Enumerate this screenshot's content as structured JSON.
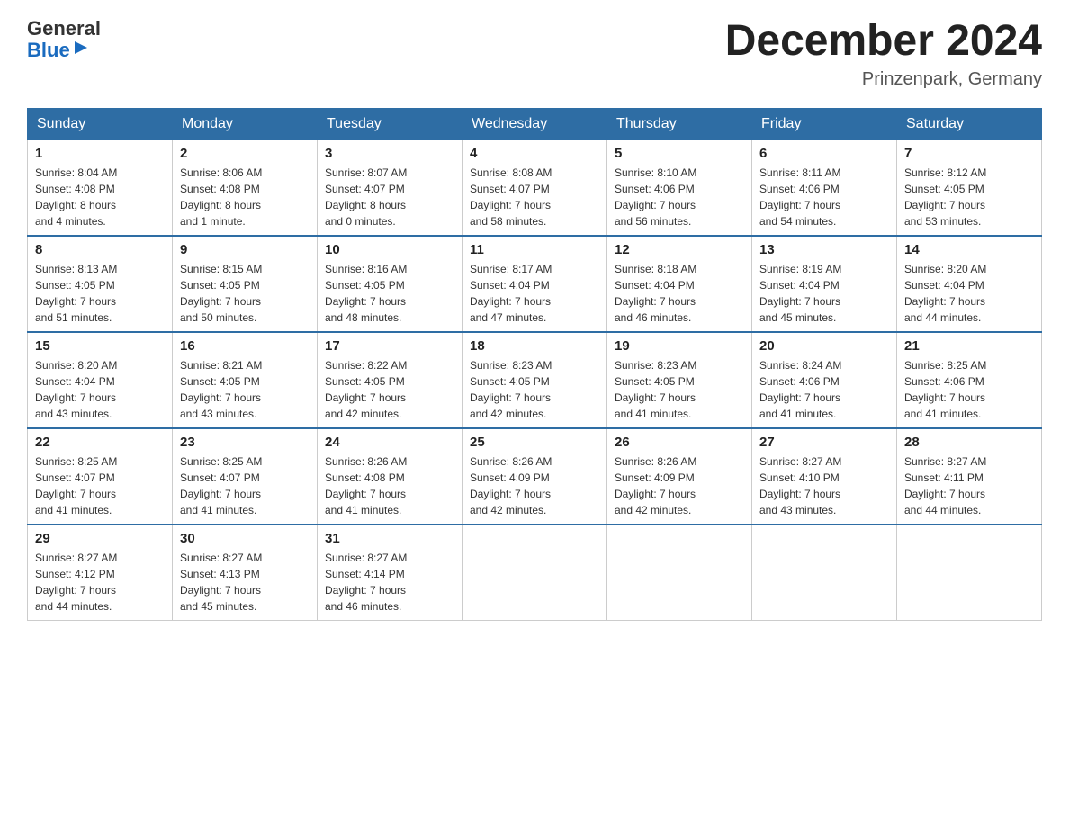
{
  "header": {
    "logo": {
      "general": "General",
      "blue": "Blue"
    },
    "title": "December 2024",
    "location": "Prinzenpark, Germany"
  },
  "days_of_week": [
    "Sunday",
    "Monday",
    "Tuesday",
    "Wednesday",
    "Thursday",
    "Friday",
    "Saturday"
  ],
  "weeks": [
    [
      {
        "day": "1",
        "sunrise": "8:04 AM",
        "sunset": "4:08 PM",
        "daylight": "8 hours and 4 minutes."
      },
      {
        "day": "2",
        "sunrise": "8:06 AM",
        "sunset": "4:08 PM",
        "daylight": "8 hours and 1 minute."
      },
      {
        "day": "3",
        "sunrise": "8:07 AM",
        "sunset": "4:07 PM",
        "daylight": "8 hours and 0 minutes."
      },
      {
        "day": "4",
        "sunrise": "8:08 AM",
        "sunset": "4:07 PM",
        "daylight": "7 hours and 58 minutes."
      },
      {
        "day": "5",
        "sunrise": "8:10 AM",
        "sunset": "4:06 PM",
        "daylight": "7 hours and 56 minutes."
      },
      {
        "day": "6",
        "sunrise": "8:11 AM",
        "sunset": "4:06 PM",
        "daylight": "7 hours and 54 minutes."
      },
      {
        "day": "7",
        "sunrise": "8:12 AM",
        "sunset": "4:05 PM",
        "daylight": "7 hours and 53 minutes."
      }
    ],
    [
      {
        "day": "8",
        "sunrise": "8:13 AM",
        "sunset": "4:05 PM",
        "daylight": "7 hours and 51 minutes."
      },
      {
        "day": "9",
        "sunrise": "8:15 AM",
        "sunset": "4:05 PM",
        "daylight": "7 hours and 50 minutes."
      },
      {
        "day": "10",
        "sunrise": "8:16 AM",
        "sunset": "4:05 PM",
        "daylight": "7 hours and 48 minutes."
      },
      {
        "day": "11",
        "sunrise": "8:17 AM",
        "sunset": "4:04 PM",
        "daylight": "7 hours and 47 minutes."
      },
      {
        "day": "12",
        "sunrise": "8:18 AM",
        "sunset": "4:04 PM",
        "daylight": "7 hours and 46 minutes."
      },
      {
        "day": "13",
        "sunrise": "8:19 AM",
        "sunset": "4:04 PM",
        "daylight": "7 hours and 45 minutes."
      },
      {
        "day": "14",
        "sunrise": "8:20 AM",
        "sunset": "4:04 PM",
        "daylight": "7 hours and 44 minutes."
      }
    ],
    [
      {
        "day": "15",
        "sunrise": "8:20 AM",
        "sunset": "4:04 PM",
        "daylight": "7 hours and 43 minutes."
      },
      {
        "day": "16",
        "sunrise": "8:21 AM",
        "sunset": "4:05 PM",
        "daylight": "7 hours and 43 minutes."
      },
      {
        "day": "17",
        "sunrise": "8:22 AM",
        "sunset": "4:05 PM",
        "daylight": "7 hours and 42 minutes."
      },
      {
        "day": "18",
        "sunrise": "8:23 AM",
        "sunset": "4:05 PM",
        "daylight": "7 hours and 42 minutes."
      },
      {
        "day": "19",
        "sunrise": "8:23 AM",
        "sunset": "4:05 PM",
        "daylight": "7 hours and 41 minutes."
      },
      {
        "day": "20",
        "sunrise": "8:24 AM",
        "sunset": "4:06 PM",
        "daylight": "7 hours and 41 minutes."
      },
      {
        "day": "21",
        "sunrise": "8:25 AM",
        "sunset": "4:06 PM",
        "daylight": "7 hours and 41 minutes."
      }
    ],
    [
      {
        "day": "22",
        "sunrise": "8:25 AM",
        "sunset": "4:07 PM",
        "daylight": "7 hours and 41 minutes."
      },
      {
        "day": "23",
        "sunrise": "8:25 AM",
        "sunset": "4:07 PM",
        "daylight": "7 hours and 41 minutes."
      },
      {
        "day": "24",
        "sunrise": "8:26 AM",
        "sunset": "4:08 PM",
        "daylight": "7 hours and 41 minutes."
      },
      {
        "day": "25",
        "sunrise": "8:26 AM",
        "sunset": "4:09 PM",
        "daylight": "7 hours and 42 minutes."
      },
      {
        "day": "26",
        "sunrise": "8:26 AM",
        "sunset": "4:09 PM",
        "daylight": "7 hours and 42 minutes."
      },
      {
        "day": "27",
        "sunrise": "8:27 AM",
        "sunset": "4:10 PM",
        "daylight": "7 hours and 43 minutes."
      },
      {
        "day": "28",
        "sunrise": "8:27 AM",
        "sunset": "4:11 PM",
        "daylight": "7 hours and 44 minutes."
      }
    ],
    [
      {
        "day": "29",
        "sunrise": "8:27 AM",
        "sunset": "4:12 PM",
        "daylight": "7 hours and 44 minutes."
      },
      {
        "day": "30",
        "sunrise": "8:27 AM",
        "sunset": "4:13 PM",
        "daylight": "7 hours and 45 minutes."
      },
      {
        "day": "31",
        "sunrise": "8:27 AM",
        "sunset": "4:14 PM",
        "daylight": "7 hours and 46 minutes."
      },
      null,
      null,
      null,
      null
    ]
  ],
  "labels": {
    "sunrise": "Sunrise:",
    "sunset": "Sunset:",
    "daylight": "Daylight:"
  }
}
